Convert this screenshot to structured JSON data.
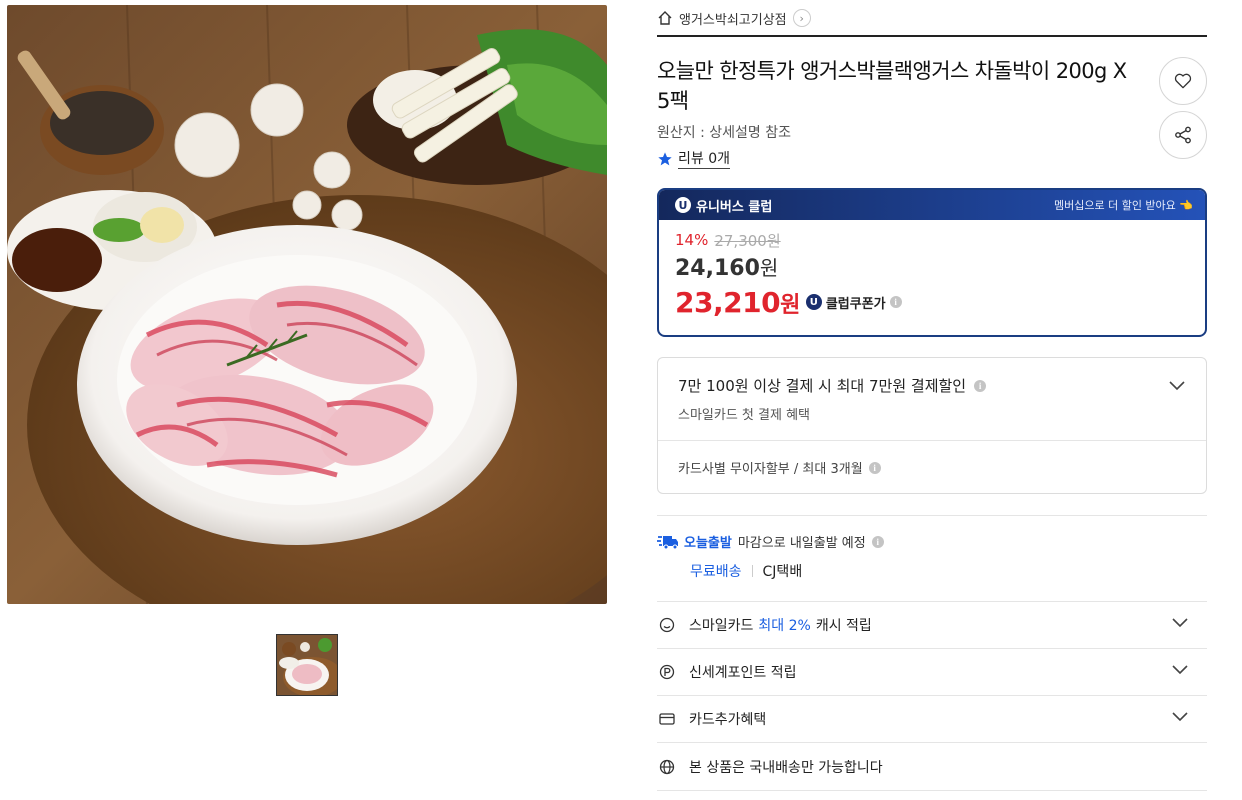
{
  "shop": {
    "name": "앵거스박쇠고기상점",
    "arrow": "›"
  },
  "product": {
    "title": "오늘만 한정특가 앵거스박블랙앵거스 차돌박이 200g X 5팩",
    "origin": "원산지 : 상세설명 참조",
    "review_label": "리뷰 0개"
  },
  "club": {
    "header_label": "유니버스 클럽",
    "header_promo": "멤버십으로 더 할인 받아요 👈",
    "u_mark": "U",
    "discount_rate": "14%",
    "original_price": "27,300원",
    "sale_price": "24,160",
    "coupon_price": "23,210",
    "won": "원",
    "coupon_label": "클럽쿠폰가",
    "info_mark": "i"
  },
  "benefit": {
    "title": "7만 100원 이상 결제 시 최대 7만원 결제할인",
    "subtitle": "스마일카드 첫 결제 혜택",
    "installment": "카드사별 무이자할부 / 최대 3개월"
  },
  "shipping": {
    "badge": "오늘출발",
    "text": "마감으로 내일출발 예정",
    "free": "무료배송",
    "carrier": "CJ택배"
  },
  "accordions": {
    "smile_pre": "스마일카드",
    "smile_highlight": "최대 2%",
    "smile_post": "캐시 적립",
    "shinsegae": "신세계포인트 적립",
    "card_benefit": "카드추가혜택",
    "domestic": "본 상품은 국내배송만 가능합니다"
  },
  "colors": {
    "accent_blue": "#1b5fe0",
    "sale_red": "#e0242d",
    "club_navy": "#1a3d82"
  }
}
